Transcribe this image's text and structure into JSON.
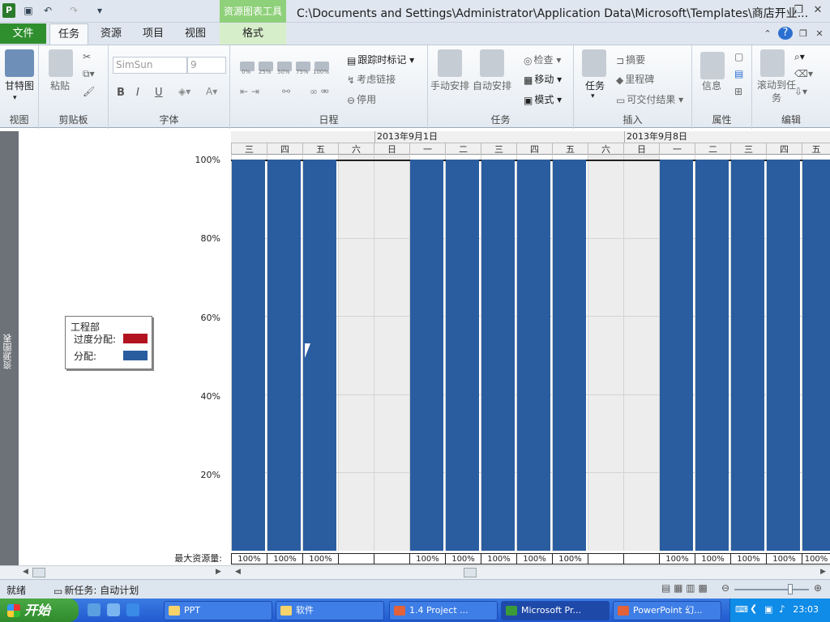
{
  "window": {
    "title": "C:\\Documents and Settings\\Administrator\\Application Data\\Microsoft\\Templates\\商店开业...",
    "context_tool": "资源图表工具"
  },
  "tabs": [
    "文件",
    "任务",
    "资源",
    "项目",
    "视图",
    "格式"
  ],
  "active_tab": "任务",
  "ribbon": {
    "view": {
      "label": "视图",
      "gantt": "甘特图"
    },
    "clipboard": {
      "label": "剪贴板",
      "paste": "粘贴"
    },
    "font": {
      "label": "字体",
      "family": "SimSun",
      "size": "9",
      "bold": "B",
      "italic": "I",
      "underline": "U"
    },
    "schedule": {
      "label": "日程",
      "zoom": [
        "0%",
        "25%",
        "50%",
        "75%",
        "100%"
      ],
      "track": "跟踪时标记",
      "respect": "考虑链接",
      "inactivate": "停用"
    },
    "tasks": {
      "label": "任务",
      "manual": "手动安排",
      "auto": "自动安排",
      "inspect": "检查",
      "move": "移动",
      "mode": "模式"
    },
    "insert": {
      "label": "插入",
      "task": "任务",
      "summary": "摘要",
      "milestone": "里程碑",
      "deliverable": "可交付结果"
    },
    "properties": {
      "label": "属性",
      "info": "信息"
    },
    "editing": {
      "label": "编辑",
      "scroll": "滚动到任务"
    }
  },
  "side_label": "资源图表",
  "timescale": {
    "weeks": [
      "2013年9月1日",
      "2013年9月8日"
    ],
    "days": [
      "三",
      "四",
      "五",
      "六",
      "日",
      "一",
      "二",
      "三",
      "四",
      "五",
      "六",
      "日",
      "一",
      "二",
      "三",
      "四",
      "五"
    ]
  },
  "y_ticks": [
    "100%",
    "80%",
    "60%",
    "40%",
    "20%"
  ],
  "legend": {
    "title": "工程部",
    "over": "过度分配:",
    "alloc": "分配:",
    "over_color": "#b3121f",
    "alloc_color": "#2a5d9f"
  },
  "max_label": "最大资源量:",
  "chart_data": {
    "type": "bar",
    "categories": [
      "三",
      "四",
      "五",
      "六",
      "日",
      "一",
      "二",
      "三",
      "四",
      "五",
      "六",
      "日",
      "一",
      "二",
      "三",
      "四",
      "五"
    ],
    "series": [
      {
        "name": "分配",
        "values": [
          100,
          100,
          100,
          0,
          0,
          100,
          100,
          100,
          100,
          100,
          0,
          0,
          100,
          100,
          100,
          100,
          100
        ]
      }
    ],
    "max_units": [
      "100%",
      "100%",
      "100%",
      "",
      "",
      "100%",
      "100%",
      "100%",
      "100%",
      "100%",
      "",
      "",
      "100%",
      "100%",
      "100%",
      "100%",
      "100%"
    ],
    "ylim": [
      0,
      100
    ],
    "grid": true
  },
  "status": {
    "ready": "就绪",
    "new_task": "新任务: 自动计划"
  },
  "taskbar": {
    "start": "开始",
    "items": [
      "PPT",
      "软件",
      "1.4 Project ...",
      "Microsoft Pr...",
      "PowerPoint 幻..."
    ],
    "clock": "23:03"
  }
}
